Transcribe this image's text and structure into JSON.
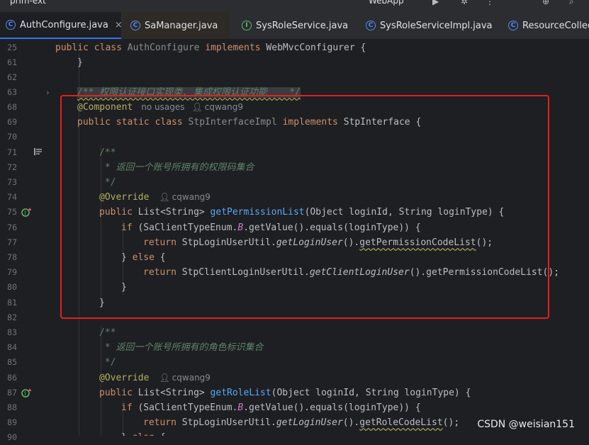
{
  "topbar": {
    "project": "prim-ext",
    "run_config": "WebApp"
  },
  "tabs": [
    {
      "label": "AuthConfigure.java",
      "icon": "C",
      "active": true
    },
    {
      "label": "SaManager.java",
      "icon": "C",
      "active": false
    },
    {
      "label": "SysRoleService.java",
      "icon": "I",
      "active": false
    },
    {
      "label": "SysRoleServiceImpl.java",
      "icon": "C",
      "active": false
    },
    {
      "label": "ResourceCollect",
      "icon": "C",
      "active": false
    }
  ],
  "lines": {
    "l25": {
      "n": "25",
      "t1": "public class ",
      "t2": "AuthConfigure ",
      "t3": "implements ",
      "t4": "WebMvcConfigurer {"
    },
    "l61": {
      "n": "61",
      "t1": "}"
    },
    "l62": {
      "n": "62"
    },
    "l63": {
      "n": "63",
      "t1": "/** 权限认证接口实现类, 集成权限认证功能    */"
    },
    "l68": {
      "n": "68",
      "t1": "@Component",
      "hint1": "no usages",
      "hint2": "cqwang9"
    },
    "l69": {
      "n": "69",
      "t1": "public static class ",
      "t2": "StpInterfaceImpl ",
      "t3": "implements ",
      "t4": "StpInterface {"
    },
    "l70": {
      "n": "70"
    },
    "l71": {
      "n": "71",
      "t1": "/**"
    },
    "l72": {
      "n": "72",
      "t1": " * ",
      "t2": "返回一个账号所拥有的权限码集合"
    },
    "l73": {
      "n": "73",
      "t1": " */"
    },
    "l74": {
      "n": "74",
      "t1": "@Override",
      "hint": "cqwang9"
    },
    "l75": {
      "n": "75",
      "t1": "public ",
      "t2": "List<String> ",
      "t3": "getPermissionList",
      "t4": "(Object loginId, String loginType) {"
    },
    "l76": {
      "n": "76",
      "t1": "if ",
      "t2": "(SaClientTypeEnum.",
      "t3": "B",
      "t4": ".getValue().equals(loginType)) {"
    },
    "l77": {
      "n": "77",
      "t1": "return ",
      "t2": "StpLoginUserUtil.",
      "t3": "getLoginUser",
      "t4": "().",
      "t5": "getPermissionCodeList",
      "t6": "();"
    },
    "l78": {
      "n": "78",
      "t1": "} ",
      "t2": "else ",
      "t3": "{"
    },
    "l79": {
      "n": "79",
      "t1": "return ",
      "t2": "StpClientLoginUserUtil.",
      "t3": "getClientLoginUser",
      "t4": "().getPermissionCodeList();"
    },
    "l80": {
      "n": "80",
      "t1": "}"
    },
    "l81": {
      "n": "81",
      "t1": "}"
    },
    "l82": {
      "n": "82"
    },
    "l83": {
      "n": "83",
      "t1": "/**"
    },
    "l84": {
      "n": "84",
      "t1": " * ",
      "t2": "返回一个账号所拥有的角色标识集合"
    },
    "l85": {
      "n": "85",
      "t1": " */"
    },
    "l86": {
      "n": "86",
      "t1": "@Override",
      "hint": "cqwang9"
    },
    "l87": {
      "n": "87",
      "t1": "public ",
      "t2": "List<String> ",
      "t3": "getRoleList",
      "t4": "(Object loginId, String loginType) {"
    },
    "l88": {
      "n": "88",
      "t1": "if ",
      "t2": "(SaClientTypeEnum.",
      "t3": "B",
      "t4": ".getValue().equals(loginType)) {"
    },
    "l89": {
      "n": "89",
      "t1": "return ",
      "t2": "StpLoginUserUtil.",
      "t3": "getLoginUser",
      "t4": "().",
      "t5": "getRoleCodeList",
      "t6": "();"
    },
    "l90": {
      "n": "90",
      "t1": "} ",
      "t2": "else ",
      "t3": "{"
    }
  },
  "watermark": "CSDN @weisian151",
  "colors": {
    "highlight_box": "#e02020",
    "active_tab_underline": "#3574f0",
    "editor_bg": "#1e1f22"
  }
}
